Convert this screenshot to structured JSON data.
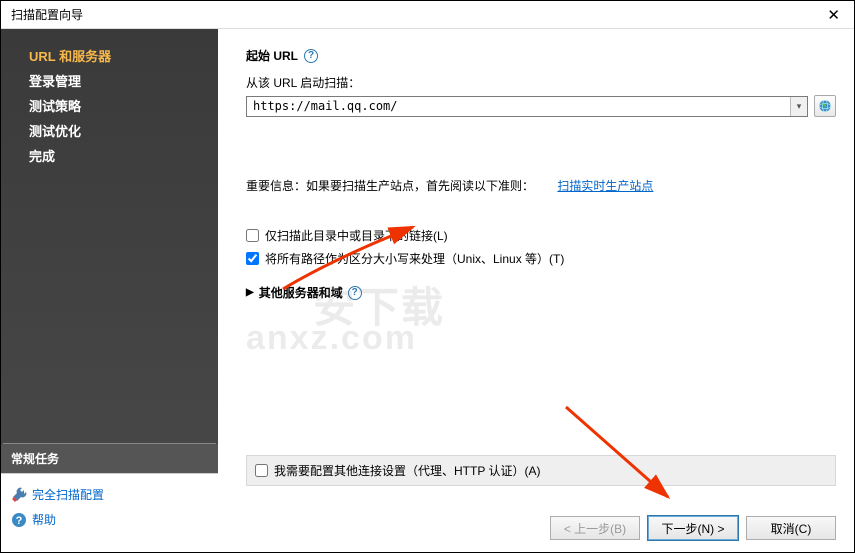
{
  "window": {
    "title": "扫描配置向导"
  },
  "sidebar": {
    "items": [
      {
        "label": "URL 和服务器",
        "active": true
      },
      {
        "label": "登录管理"
      },
      {
        "label": "测试策略"
      },
      {
        "label": "测试优化"
      },
      {
        "label": "完成"
      }
    ],
    "tasks_header": "常规任务",
    "tasks": [
      {
        "label": "完全扫描配置",
        "icon": "wrench"
      },
      {
        "label": "帮助",
        "icon": "help"
      }
    ]
  },
  "main": {
    "heading": "起始 URL",
    "sub_label": "从该 URL 启动扫描：",
    "url_value": "https://mail.qq.com/",
    "info_prefix": "重要信息：如果要扫描生产站点，首先阅读以下准则：",
    "info_link": "扫描实时生产站点",
    "check1": {
      "label": "仅扫描此目录中或目录下的链接(L)",
      "checked": false
    },
    "check2": {
      "label": "将所有路径作为区分大小写来处理（Unix、Linux 等）(T)",
      "checked": true
    },
    "expander_label": "其他服务器和域",
    "bottom_check": {
      "label": "我需要配置其他连接设置（代理、HTTP 认证）(A)",
      "checked": false
    }
  },
  "buttons": {
    "back": "< 上一步(B)",
    "next": "下一步(N) >",
    "cancel": "取消(C)"
  },
  "watermark": {
    "line1": "安下载",
    "line2": "anxz.com"
  }
}
